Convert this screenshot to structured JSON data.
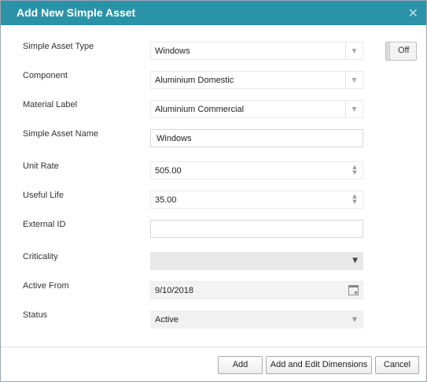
{
  "dialog": {
    "title": "Add New Simple Asset",
    "close_glyph": "✕"
  },
  "toggle": {
    "label": "Off"
  },
  "form": {
    "simple_asset_type": {
      "label": "Simple Asset Type",
      "value": "Windows"
    },
    "component": {
      "label": "Component",
      "value": "Aluminium Domestic"
    },
    "material_label": {
      "label": "Material Label",
      "value": "Aluminium Commercial"
    },
    "simple_asset_name": {
      "label": "Simple Asset Name",
      "value": "Windows"
    },
    "unit_rate": {
      "label": "Unit Rate",
      "value": "505.00"
    },
    "useful_life": {
      "label": "Useful Life",
      "value": "35.00"
    },
    "external_id": {
      "label": "External ID",
      "value": ""
    },
    "criticality": {
      "label": "Criticality",
      "value": ""
    },
    "active_from": {
      "label": "Active From",
      "value": "9/10/2018"
    },
    "status": {
      "label": "Status",
      "value": "Active"
    }
  },
  "buttons": {
    "add": "Add",
    "add_edit": "Add and Edit Dimensions",
    "cancel": "Cancel"
  },
  "icons": {
    "dropdown_arrow": "▼",
    "spin_up": "▲",
    "spin_down": "▼"
  },
  "colors": {
    "titlebar": "#2b93a8",
    "title_text": "#ffffff"
  }
}
